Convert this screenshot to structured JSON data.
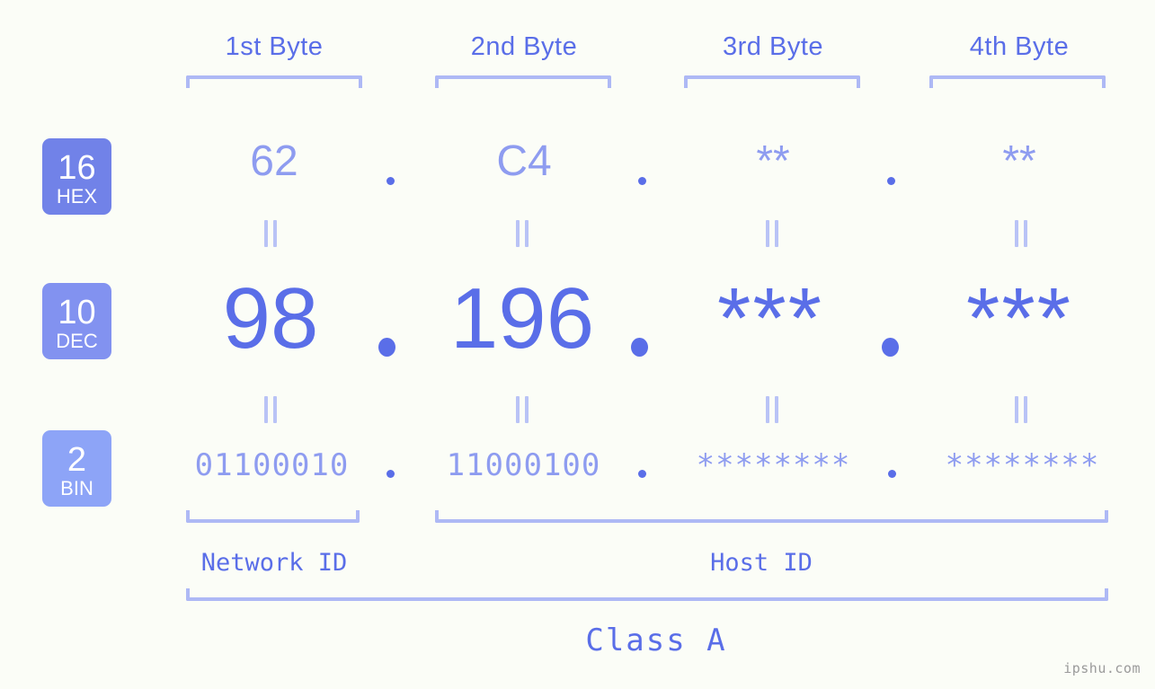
{
  "meta": {
    "background_color": "#fbfdf7",
    "accent_color": "#5a6ee8",
    "accent_light_color": "#8e9cf0",
    "bracket_color": "#aeb9f5"
  },
  "byte_headers": [
    {
      "label": "1st Byte"
    },
    {
      "label": "2nd Byte"
    },
    {
      "label": "3rd Byte"
    },
    {
      "label": "4th Byte"
    }
  ],
  "rows": [
    {
      "badge": {
        "number": "16",
        "name": "HEX",
        "color": "#7182e8"
      },
      "values": [
        "62",
        "C4",
        "**",
        "**"
      ],
      "separator": "."
    },
    {
      "badge": {
        "number": "10",
        "name": "DEC",
        "color": "#8292f0"
      },
      "values": [
        "98",
        "196",
        "***",
        "***"
      ],
      "separator": "."
    },
    {
      "badge": {
        "number": "2",
        "name": "BIN",
        "color": "#8da4f7"
      },
      "values": [
        "01100010",
        "11000100",
        "********",
        "********"
      ],
      "separator": "."
    }
  ],
  "equality_symbol": "||",
  "segments": {
    "network_id": "Network ID",
    "host_id": "Host ID"
  },
  "class_label": "Class A",
  "watermark": "ipshu.com"
}
